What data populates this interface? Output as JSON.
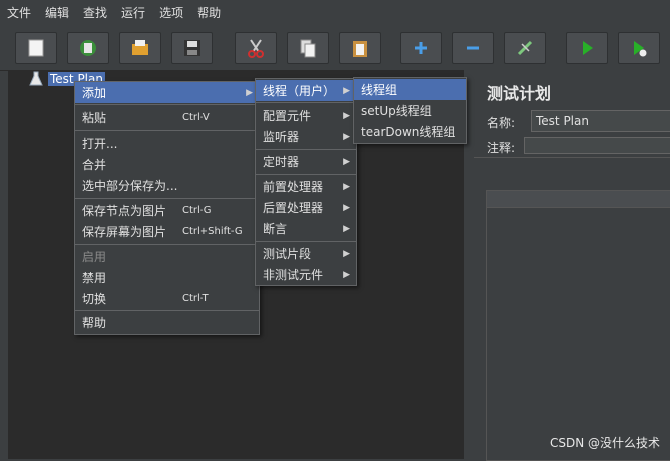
{
  "menubar": [
    "文件",
    "编辑",
    "查找",
    "运行",
    "选项",
    "帮助"
  ],
  "toolbar": {
    "icons": [
      "new-icon",
      "templates-icon",
      "open-icon",
      "save-icon",
      "cut-icon",
      "copy-icon",
      "paste-icon",
      "expand-icon",
      "collapse-icon",
      "toggle-icon",
      "start-icon",
      "start-no-pauses-icon"
    ]
  },
  "tree": {
    "root_label": "Test Plan"
  },
  "context_menu": {
    "items": [
      {
        "label": "添加",
        "shortcut": ""
      },
      {
        "label": "粘贴",
        "shortcut": "Ctrl-V"
      },
      {
        "label": "打开...",
        "shortcut": ""
      },
      {
        "label": "合并",
        "shortcut": ""
      },
      {
        "label": "选中部分保存为...",
        "shortcut": ""
      },
      {
        "label": "保存节点为图片",
        "shortcut": "Ctrl-G"
      },
      {
        "label": "保存屏幕为图片",
        "shortcut": "Ctrl+Shift-G"
      },
      {
        "label": "启用",
        "shortcut": ""
      },
      {
        "label": "禁用",
        "shortcut": ""
      },
      {
        "label": "切换",
        "shortcut": "Ctrl-T"
      },
      {
        "label": "帮助",
        "shortcut": ""
      }
    ]
  },
  "add_submenu": {
    "items": [
      {
        "label": "线程（用户）"
      },
      {
        "label": "配置元件"
      },
      {
        "label": "监听器"
      },
      {
        "label": "定时器"
      },
      {
        "label": "前置处理器"
      },
      {
        "label": "后置处理器"
      },
      {
        "label": "断言"
      },
      {
        "label": "测试片段"
      },
      {
        "label": "非测试元件"
      }
    ]
  },
  "thread_submenu": {
    "items": [
      {
        "label": "线程组"
      },
      {
        "label": "setUp线程组"
      },
      {
        "label": "tearDown线程组"
      }
    ]
  },
  "right_panel": {
    "title": "测试计划",
    "name_label": "名称:",
    "name_value": "Test Plan",
    "comment_label": "注释:"
  },
  "watermark": "CSDN @没什么技术"
}
